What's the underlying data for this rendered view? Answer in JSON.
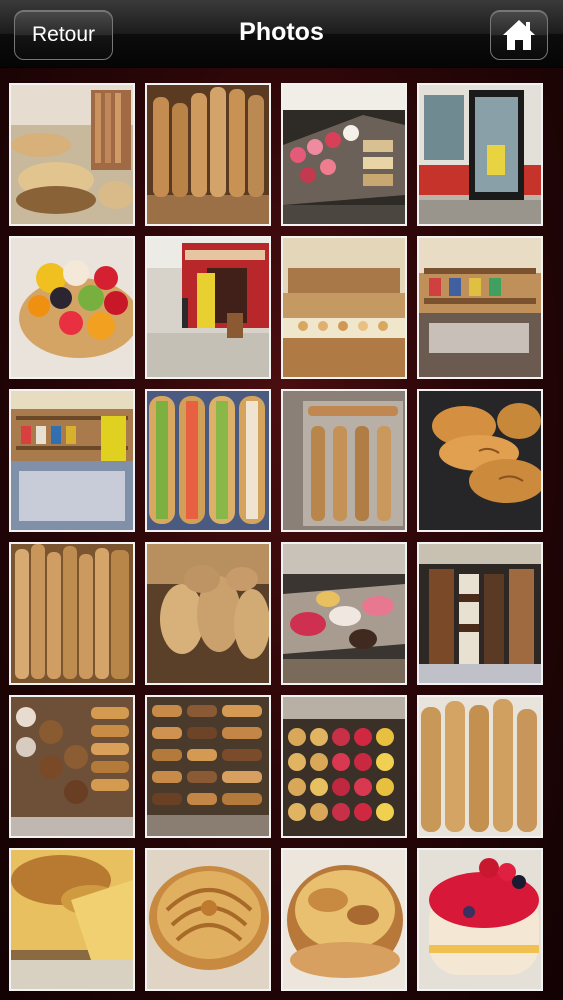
{
  "navbar": {
    "title": "Photos",
    "back_label": "Retour",
    "home_icon": "home-icon"
  },
  "photos": [
    {
      "name": "photo-pastry-counter-baskets"
    },
    {
      "name": "photo-baguettes-rack"
    },
    {
      "name": "photo-dessert-display-case"
    },
    {
      "name": "photo-bakery-storefront-door"
    },
    {
      "name": "photo-fruit-tart"
    },
    {
      "name": "photo-boulangerie-street-front"
    },
    {
      "name": "photo-bakery-interior-counter"
    },
    {
      "name": "photo-bakery-shelves-interior"
    },
    {
      "name": "photo-shop-shelves-products"
    },
    {
      "name": "photo-sandwich-baguettes"
    },
    {
      "name": "photo-baguettes-on-tray"
    },
    {
      "name": "photo-croissants"
    },
    {
      "name": "photo-baguettes-basket"
    },
    {
      "name": "photo-round-loaves"
    },
    {
      "name": "photo-cakes-display"
    },
    {
      "name": "photo-pastry-rows-display"
    },
    {
      "name": "photo-religieuses-eclairs"
    },
    {
      "name": "photo-eclairs-tray"
    },
    {
      "name": "photo-tartlets-tray"
    },
    {
      "name": "photo-baguettes-closeup"
    },
    {
      "name": "photo-creme-brulee-tart"
    },
    {
      "name": "photo-apple-tart"
    },
    {
      "name": "photo-flan-tart"
    },
    {
      "name": "photo-red-fruit-cake"
    }
  ]
}
